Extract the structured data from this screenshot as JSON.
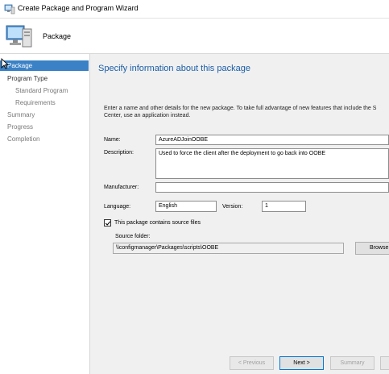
{
  "window": {
    "title": "Create Package and Program Wizard"
  },
  "header": {
    "title": "Package"
  },
  "nav": {
    "items": [
      {
        "label": "Package"
      },
      {
        "label": "Program Type"
      },
      {
        "label": "Standard Program"
      },
      {
        "label": "Requirements"
      },
      {
        "label": "Summary"
      },
      {
        "label": "Progress"
      },
      {
        "label": "Completion"
      }
    ]
  },
  "content": {
    "heading": "Specify information about this package",
    "intro_line1": "Enter a name and other details for the new package. To take full advantage of new features that include the S",
    "intro_line2": "Center, use an application instead.",
    "name_label": "Name:",
    "name_value": "AzureADJoinOOBE",
    "description_label": "Description:",
    "description_value": "Used to force the client after the deployment to go back into OOBE",
    "manufacturer_label": "Manufacturer:",
    "manufacturer_value": "",
    "language_label": "Language:",
    "language_value": "English",
    "version_label": "Version:",
    "version_value": "1",
    "source_checkbox_label": "This package contains source files",
    "source_checked": true,
    "source_folder_label": "Source folder:",
    "source_folder_value": "\\\\configmanager\\Packages\\scripts\\OOBE",
    "browse_label": "Browse"
  },
  "footer": {
    "previous_label": "< Previous",
    "next_label": "Next >",
    "summary_label": "Summary"
  },
  "colors": {
    "accent": "#3a81c6",
    "heading": "#1a5ea8"
  }
}
